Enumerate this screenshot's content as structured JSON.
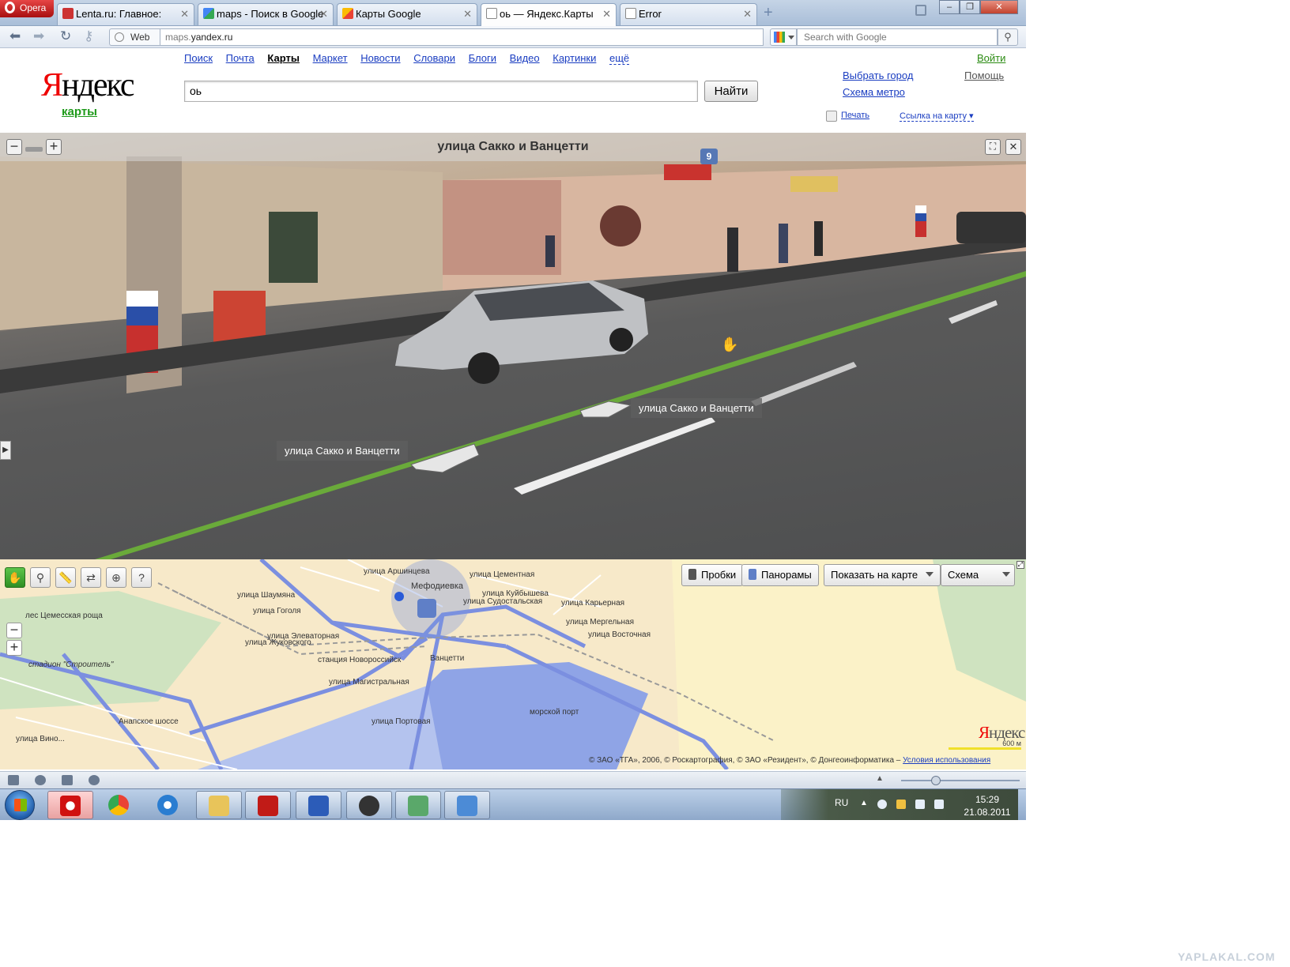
{
  "browser": {
    "menu_label": "Opera",
    "tabs": [
      {
        "label": "Lenta.ru: Главное:",
        "active": false
      },
      {
        "label": "maps - Поиск в Google",
        "active": false
      },
      {
        "label": "Карты Google",
        "active": false
      },
      {
        "label": "оь — Яндекс.Карты",
        "active": true
      },
      {
        "label": "Error",
        "active": false
      }
    ],
    "web_label": "Web",
    "url_prefix": "maps.",
    "url_host": "yandex.ru",
    "search_placeholder": "Search with Google"
  },
  "yandex": {
    "logo_red": "Я",
    "logo_rest": "ндекс",
    "service": "карты",
    "nav": [
      {
        "label": "Поиск",
        "current": false
      },
      {
        "label": "Почта",
        "current": false
      },
      {
        "label": "Карты",
        "current": true
      },
      {
        "label": "Маркет",
        "current": false
      },
      {
        "label": "Новости",
        "current": false
      },
      {
        "label": "Словари",
        "current": false
      },
      {
        "label": "Блоги",
        "current": false
      },
      {
        "label": "Видео",
        "current": false
      },
      {
        "label": "Картинки",
        "current": false
      },
      {
        "label": "ещё",
        "current": false
      }
    ],
    "query": "оь",
    "find_label": "Найти",
    "login": "Войти",
    "help": "Помощь",
    "choose_city": "Выбрать город",
    "metro_map": "Схема метро",
    "print": "Печать",
    "map_link": "Ссылка на карту ▾"
  },
  "panorama": {
    "title": "улица Сакко и Ванцетти",
    "badge": "9",
    "label_forward": "улица Сакко и Ванцетти",
    "label_back": "улица Сакко и Ванцетти",
    "zoom_out": "−",
    "zoom_in": "+",
    "expand": "⛶",
    "close": "✕"
  },
  "map": {
    "traffic_label": "Пробки",
    "panoramas_label": "Панорамы",
    "show_on_map_label": "Показать на карте",
    "layer_label": "Схема",
    "logo_red": "Я",
    "logo_rest": "ндекс",
    "scale_label": "600 м",
    "copyright": "© ЗАО «ТГА», 2006, © Роскартография, © ЗАО «Резидент», © Донгеоинформатика –",
    "terms_link": "Условия использования",
    "labels": {
      "grove": "лес Цемесская роща",
      "stadium": "стадион \"Строитель\"",
      "station": "станция Новороссийск",
      "port": "морской порт",
      "depot": "Мефодиевка",
      "street_magistral": "улица Магистральная",
      "street_gogol": "улица Гоголя",
      "street_shaumyan": "улица Шаумяна",
      "street_elevator": "улица Элеваторная",
      "street_zhukovsky": "улица Жуковского",
      "street_kuibyshev": "улица Куйбышева",
      "street_cement": "улица Цементная",
      "street_karer": "улица Карьерная",
      "street_mergel": "улица Мергельная",
      "street_vostoch": "улица Восточная",
      "street_vanzetti": "Ванцетти",
      "street_portov": "улица Портовая",
      "street_anapa": "Анапское шоссе",
      "street_vino": "улица Вино...",
      "street_aroma": "улица Аршинцева",
      "street_sud": "улица Судостальская"
    }
  },
  "taskbar": {
    "language": "RU",
    "time": "15:29",
    "date": "21.08.2011"
  },
  "watermark": "YAPLAKAL.COM",
  "colors": {
    "yandex_red": "#ee0000",
    "link_blue": "#1a3dc1",
    "green": "#2b8b12",
    "road_blue": "#7b8fe0",
    "water": "#8fa4e6"
  }
}
